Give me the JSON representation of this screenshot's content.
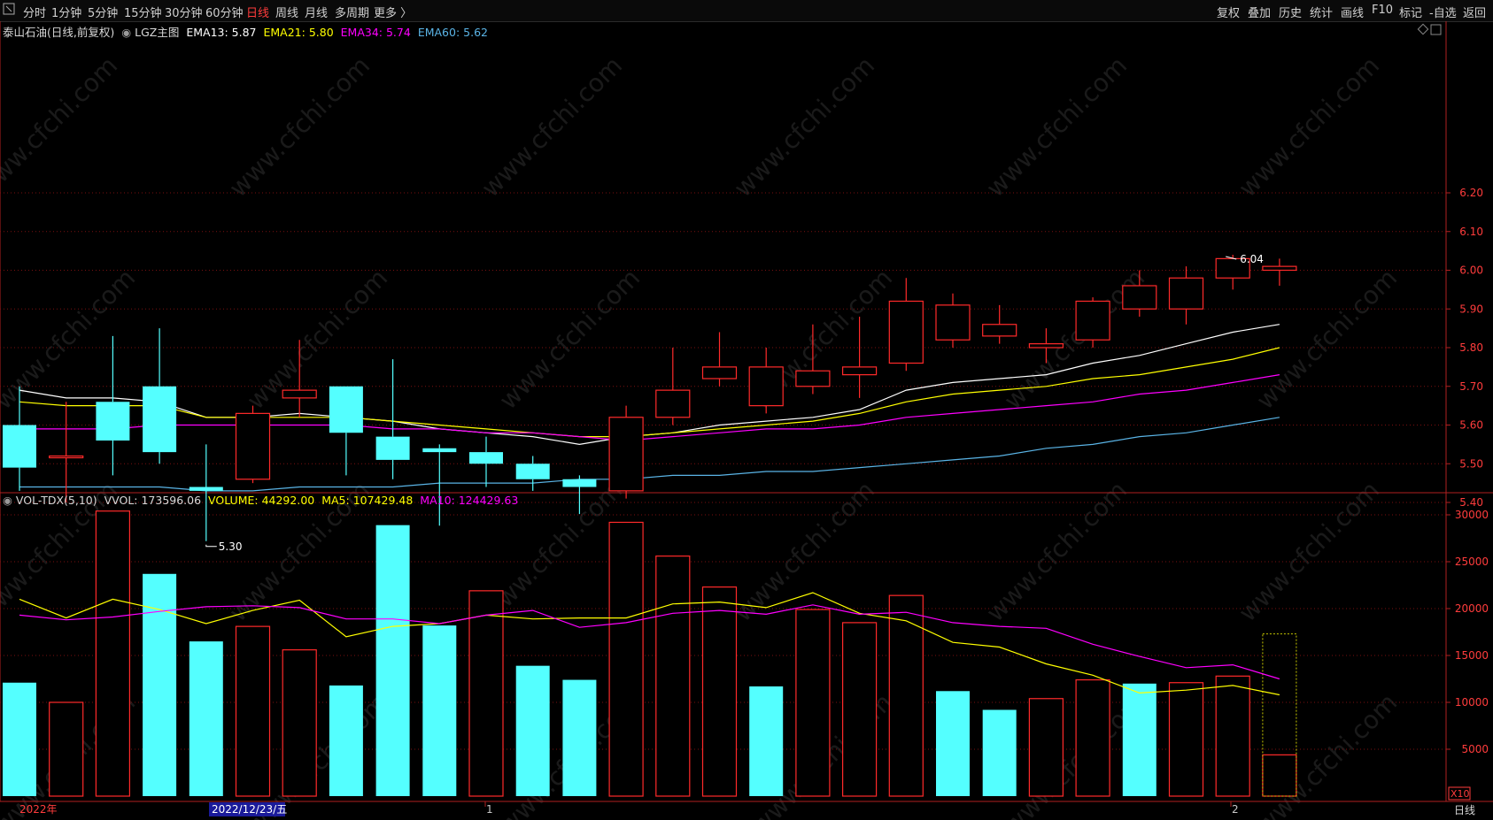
{
  "toolbar": {
    "left_tabs": [
      "分时",
      "1分钟",
      "5分钟",
      "15分钟",
      "30分钟",
      "60分钟",
      "日线",
      "周线",
      "月线",
      "多周期",
      "更多 〉"
    ],
    "active_tab": "日线",
    "right_buttons": [
      "复权",
      "叠加",
      "历史",
      "统计",
      "画线",
      "F10",
      "标记",
      "-自选",
      "返回"
    ]
  },
  "main_indicator": {
    "title": "泰山石油(日线,前复权)",
    "study": "LGZ主图",
    "ema13": "EMA13: 5.87",
    "ema21": "EMA21: 5.80",
    "ema34": "EMA34: 5.74",
    "ema60": "EMA60: 5.62"
  },
  "vol_indicator": {
    "title": "VOL-TDX(5,10)",
    "vvol": "VVOL: 173596.06",
    "volume": "VOLUME: 44292.00",
    "ma5": "MA5: 107429.48",
    "ma10": "MA10: 124429.63"
  },
  "bottom_axis": {
    "year_label": "2022年",
    "cursor_date": "2022/12/23/五",
    "tick_1": "1",
    "tick_2": "2",
    "scale_label": "X10",
    "period_label": "日线"
  },
  "annotations": {
    "high": "6.04",
    "low": "5.30"
  },
  "watermark": "www.cfchi.com",
  "colors": {
    "up": "#ff2a2a",
    "down": "#54ffff",
    "ema13": "#ffffff",
    "ema21": "#ffff00",
    "ema34": "#ff00ff",
    "ema60": "#5ab4e6",
    "ma5": "#ffff00",
    "ma10": "#ff00ff"
  },
  "chart_data": [
    {
      "type": "candlestick",
      "ylim": [
        5.3,
        6.3
      ],
      "yticks": [
        "6.20",
        "6.10",
        "6.00",
        "5.90",
        "5.80",
        "5.70",
        "5.60",
        "5.50",
        "5.40"
      ],
      "candles": [
        {
          "o": 5.6,
          "h": 5.7,
          "l": 5.43,
          "c": 5.49
        },
        {
          "o": 5.52,
          "h": 5.66,
          "l": 5.4,
          "c": 5.52
        },
        {
          "o": 5.66,
          "h": 5.83,
          "l": 5.47,
          "c": 5.56
        },
        {
          "o": 5.7,
          "h": 5.85,
          "l": 5.5,
          "c": 5.53
        },
        {
          "o": 5.44,
          "h": 5.55,
          "l": 5.3,
          "c": 5.43
        },
        {
          "o": 5.46,
          "h": 5.65,
          "l": 5.45,
          "c": 5.63
        },
        {
          "o": 5.67,
          "h": 5.82,
          "l": 5.62,
          "c": 5.69
        },
        {
          "o": 5.7,
          "h": 5.7,
          "l": 5.47,
          "c": 5.58
        },
        {
          "o": 5.57,
          "h": 5.77,
          "l": 5.46,
          "c": 5.51
        },
        {
          "o": 5.54,
          "h": 5.55,
          "l": 5.34,
          "c": 5.53
        },
        {
          "o": 5.53,
          "h": 5.57,
          "l": 5.44,
          "c": 5.5
        },
        {
          "o": 5.5,
          "h": 5.52,
          "l": 5.43,
          "c": 5.46
        },
        {
          "o": 5.46,
          "h": 5.47,
          "l": 5.37,
          "c": 5.44
        },
        {
          "o": 5.43,
          "h": 5.65,
          "l": 5.41,
          "c": 5.62
        },
        {
          "o": 5.62,
          "h": 5.8,
          "l": 5.6,
          "c": 5.69
        },
        {
          "o": 5.72,
          "h": 5.84,
          "l": 5.7,
          "c": 5.75
        },
        {
          "o": 5.65,
          "h": 5.8,
          "l": 5.63,
          "c": 5.75
        },
        {
          "o": 5.7,
          "h": 5.86,
          "l": 5.68,
          "c": 5.74
        },
        {
          "o": 5.73,
          "h": 5.88,
          "l": 5.67,
          "c": 5.75
        },
        {
          "o": 5.76,
          "h": 5.98,
          "l": 5.74,
          "c": 5.92
        },
        {
          "o": 5.82,
          "h": 5.94,
          "l": 5.8,
          "c": 5.91
        },
        {
          "o": 5.83,
          "h": 5.91,
          "l": 5.81,
          "c": 5.86
        },
        {
          "o": 5.8,
          "h": 5.85,
          "l": 5.76,
          "c": 5.81
        },
        {
          "o": 5.82,
          "h": 5.93,
          "l": 5.8,
          "c": 5.92
        },
        {
          "o": 5.9,
          "h": 6.0,
          "l": 5.88,
          "c": 5.96
        },
        {
          "o": 5.9,
          "h": 6.01,
          "l": 5.86,
          "c": 5.98
        },
        {
          "o": 5.98,
          "h": 6.04,
          "l": 5.95,
          "c": 6.03
        },
        {
          "o": 6.0,
          "h": 6.03,
          "l": 5.96,
          "c": 6.01
        }
      ],
      "series": [
        {
          "name": "EMA13",
          "values": [
            5.69,
            5.67,
            5.67,
            5.66,
            5.62,
            5.62,
            5.63,
            5.62,
            5.61,
            5.59,
            5.58,
            5.57,
            5.55,
            5.57,
            5.58,
            5.6,
            5.61,
            5.62,
            5.64,
            5.69,
            5.71,
            5.72,
            5.73,
            5.76,
            5.78,
            5.81,
            5.84,
            5.86
          ]
        },
        {
          "name": "EMA21",
          "values": [
            5.66,
            5.65,
            5.65,
            5.65,
            5.62,
            5.62,
            5.62,
            5.62,
            5.61,
            5.6,
            5.59,
            5.58,
            5.57,
            5.57,
            5.58,
            5.59,
            5.6,
            5.61,
            5.63,
            5.66,
            5.68,
            5.69,
            5.7,
            5.72,
            5.73,
            5.75,
            5.77,
            5.8
          ]
        },
        {
          "name": "EMA34",
          "values": [
            5.59,
            5.59,
            5.59,
            5.6,
            5.6,
            5.6,
            5.6,
            5.6,
            5.59,
            5.59,
            5.58,
            5.58,
            5.57,
            5.56,
            5.57,
            5.58,
            5.59,
            5.59,
            5.6,
            5.62,
            5.63,
            5.64,
            5.65,
            5.66,
            5.68,
            5.69,
            5.71,
            5.73
          ]
        },
        {
          "name": "EMA60",
          "values": [
            5.44,
            5.44,
            5.44,
            5.44,
            5.43,
            5.43,
            5.44,
            5.44,
            5.44,
            5.45,
            5.45,
            5.45,
            5.46,
            5.46,
            5.47,
            5.47,
            5.48,
            5.48,
            5.49,
            5.5,
            5.51,
            5.52,
            5.54,
            5.55,
            5.57,
            5.58,
            5.6,
            5.62
          ]
        }
      ]
    },
    {
      "type": "bar",
      "ylim": [
        0,
        31000
      ],
      "yticks": [
        "30000",
        "25000",
        "20000",
        "15000",
        "10000",
        "5000"
      ],
      "values": [
        12100,
        10000,
        30400,
        23700,
        16500,
        18100,
        15600,
        11800,
        28900,
        18200,
        21900,
        13900,
        12400,
        29200,
        25600,
        22300,
        11700,
        19900,
        18500,
        21400,
        11200,
        9200,
        10400,
        12400,
        12000,
        12100,
        12800,
        4400
      ],
      "up": [
        false,
        true,
        true,
        false,
        false,
        true,
        true,
        false,
        false,
        false,
        true,
        false,
        false,
        true,
        true,
        true,
        false,
        true,
        true,
        true,
        false,
        false,
        true,
        true,
        false,
        true,
        true,
        true
      ],
      "partial_last_estimate": 17300,
      "series": [
        {
          "name": "MA5",
          "values": [
            21000,
            19000,
            21000,
            19900,
            18400,
            19800,
            20900,
            17000,
            18100,
            18400,
            19300,
            18900,
            19000,
            19000,
            20500,
            20700,
            20100,
            21700,
            19500,
            18700,
            16400,
            15900,
            14100,
            12900,
            11000,
            11300,
            11800,
            10800
          ]
        },
        {
          "name": "MA10",
          "values": [
            19300,
            18800,
            19100,
            19700,
            20200,
            20300,
            20100,
            18900,
            18900,
            18400,
            19300,
            19800,
            18000,
            18500,
            19500,
            19800,
            19400,
            20400,
            19400,
            19600,
            18500,
            18100,
            17900,
            16200,
            14900,
            13700,
            14000,
            12500
          ]
        }
      ]
    }
  ]
}
